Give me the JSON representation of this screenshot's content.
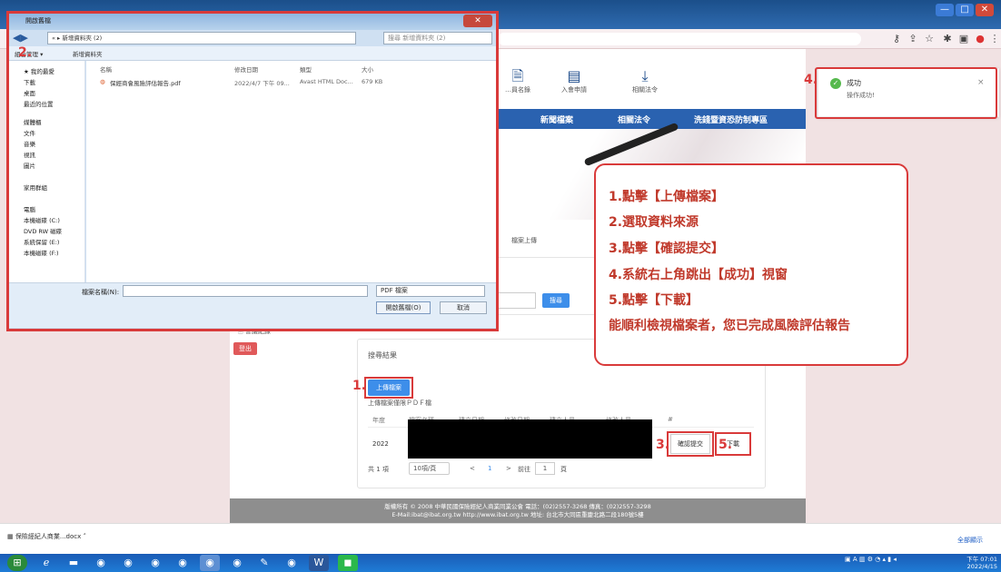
{
  "browser": {
    "buttons": [
      "—",
      "□",
      "✕"
    ]
  },
  "site": {
    "top_icons": [
      {
        "label": "…員名錄",
        "icon": "doc-icon"
      },
      {
        "label": "入會申請",
        "icon": "form-icon"
      },
      {
        "label": "相關法令",
        "icon": "download-icon"
      }
    ],
    "nav": [
      "新聞檔案",
      "相關法令",
      "洗錢暨資恐防制專區"
    ],
    "breadcrumb": "檔案上傳",
    "search_button": "搜尋",
    "side_heading": "🗎 會議紀錄",
    "side_button": "登出",
    "panel_title": "搜尋結果",
    "upload_button": "上傳檔案",
    "upload_hint": "上傳檔案僅限ＰＤＦ檔",
    "table_headers": [
      "年度",
      "檔案名稱",
      "建立日期",
      "修改日期",
      "建立人員",
      "修改人員",
      "#"
    ],
    "row_year": "2022",
    "confirm_button": "確認提交",
    "download_button": "下載",
    "pager": {
      "total": "共 1 項",
      "size": "10項/頁",
      "prev": "<",
      "page": "1",
      "next": ">",
      "goto": "前往",
      "goto_val": "1",
      "suffix": "頁"
    },
    "footer_line1": "版權所有 © 2008 中華民國保險經紀人商業同業公會 電話：(02)2557-3268 傳真：(02)2557-3298",
    "footer_line2": "E-Mail:ibat@ibat.org.tw http://www.ibat.org.tw 地址: 台北市大同區重慶北路二段180號5樓"
  },
  "dialog": {
    "title": "開啟舊檔",
    "path": "« ▸ 新增資料夾 (2)",
    "search_placeholder": "搜尋 新增資料夾 (2)",
    "toolbar": [
      "組合管理 ▾",
      "新增資料夾"
    ],
    "left_tree": [
      "★ 我的最愛",
      "下載",
      "桌面",
      "最近的位置",
      "媒體櫃",
      "文件",
      "音樂",
      "視訊",
      "圖片",
      "家用群組",
      "電腦",
      "本機磁碟 (C:)",
      "DVD RW 磁碟",
      "系統保留 (E:)",
      "本機磁碟 (F:)"
    ],
    "columns": [
      "名稱",
      "修改日期",
      "類型",
      "大小"
    ],
    "file": {
      "name": "保經商會風險評估報告.pdf",
      "date": "2022/4/7 下午 09...",
      "type": "Avast HTML Doc...",
      "size": "679 KB"
    },
    "filename_label": "檔案名稱(N):",
    "filetype": "PDF 檔案",
    "open_button": "開啟舊檔(O)",
    "cancel_button": "取消"
  },
  "toast": {
    "title": "成功",
    "message": "操作成功!",
    "close": "×"
  },
  "callout": [
    "1.點擊【上傳檔案】",
    "2.選取資料來源",
    "3.點擊【確認提交】",
    "4.系統右上角跳出【成功】視窗",
    "5.點擊【下載】",
    "能順利檢視檔案者，您已完成風險評估報告"
  ],
  "marks": [
    "1.",
    "2.",
    "3.",
    "4.",
    "5."
  ],
  "downloads": {
    "item": "保險經紀人商業...docx",
    "show_all": "全部顯示"
  },
  "taskbar": {
    "time": "下午 07:01",
    "date": "2022/4/15"
  }
}
